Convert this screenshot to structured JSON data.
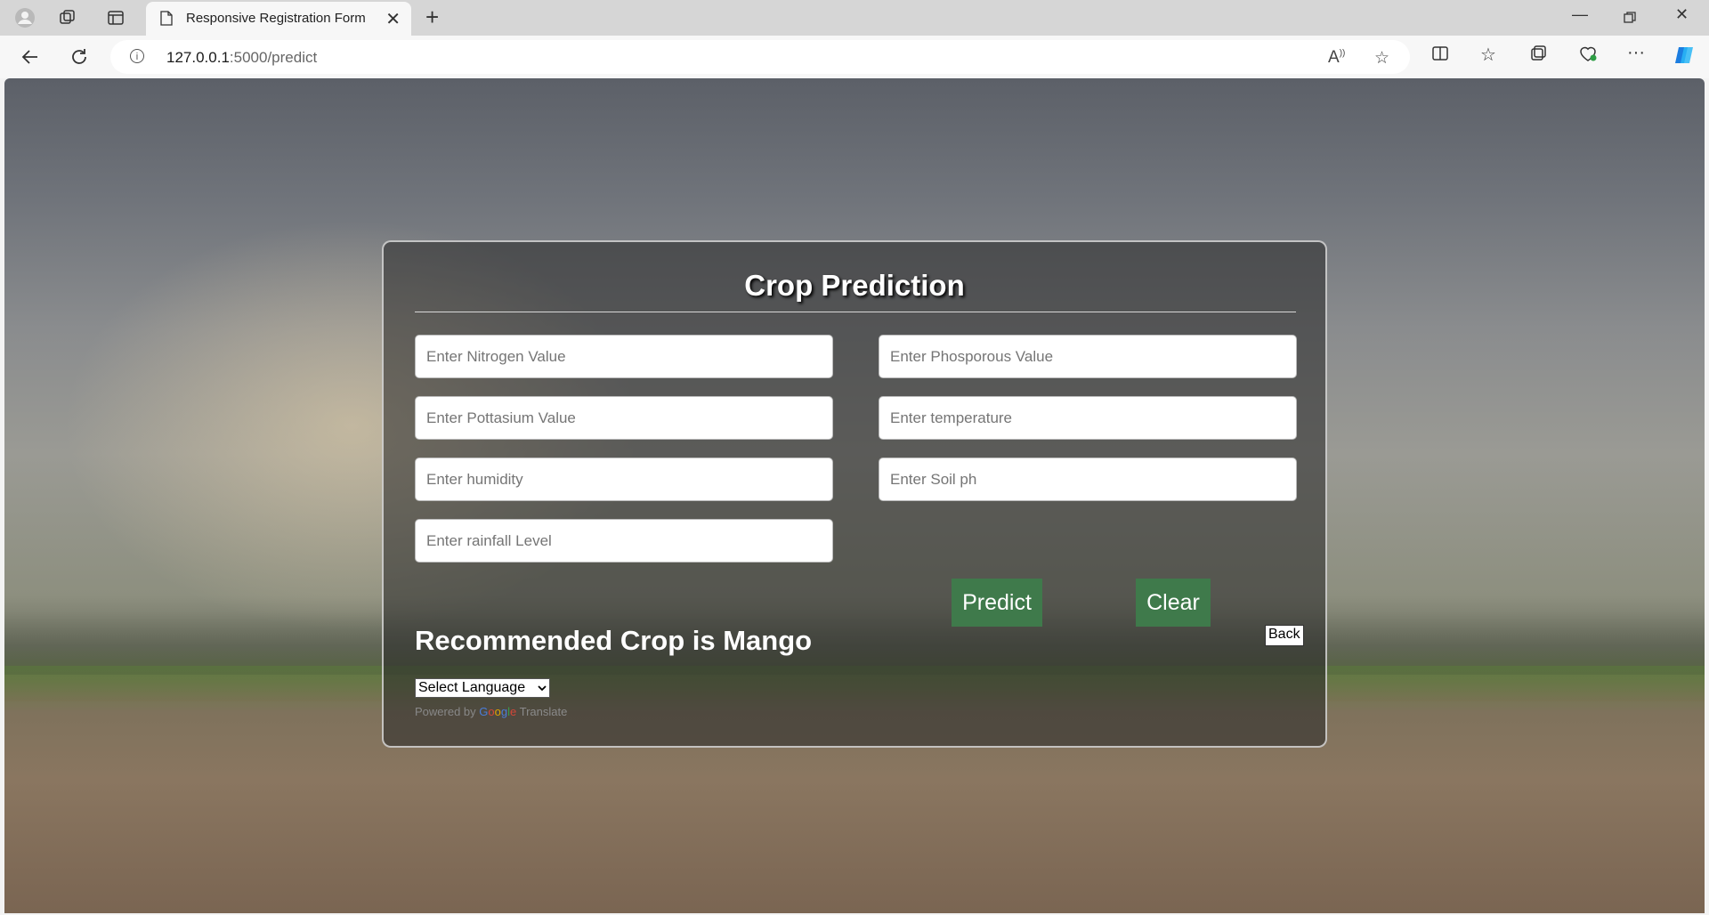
{
  "browser": {
    "tab_title": "Responsive Registration Form",
    "url_host": "127.0.0.1",
    "url_path": ":5000/predict"
  },
  "form": {
    "title": "Crop Prediction",
    "fields": {
      "nitrogen_placeholder": "Enter Nitrogen Value",
      "phosphorous_placeholder": "Enter Phosporous Value",
      "potassium_placeholder": "Enter Pottasium Value",
      "temperature_placeholder": "Enter temperature",
      "humidity_placeholder": "Enter humidity",
      "ph_placeholder": "Enter Soil ph",
      "rainfall_placeholder": "Enter rainfall Level"
    },
    "predict_label": "Predict",
    "clear_label": "Clear",
    "result_text": "Recommended Crop is Mango",
    "back_label": "Back",
    "language_select_value": "Select Language",
    "powered_by": "Powered by",
    "translate_label": "Translate"
  },
  "colors": {
    "button_green": "#3f7a4b",
    "card_border": "#ebebeb"
  }
}
